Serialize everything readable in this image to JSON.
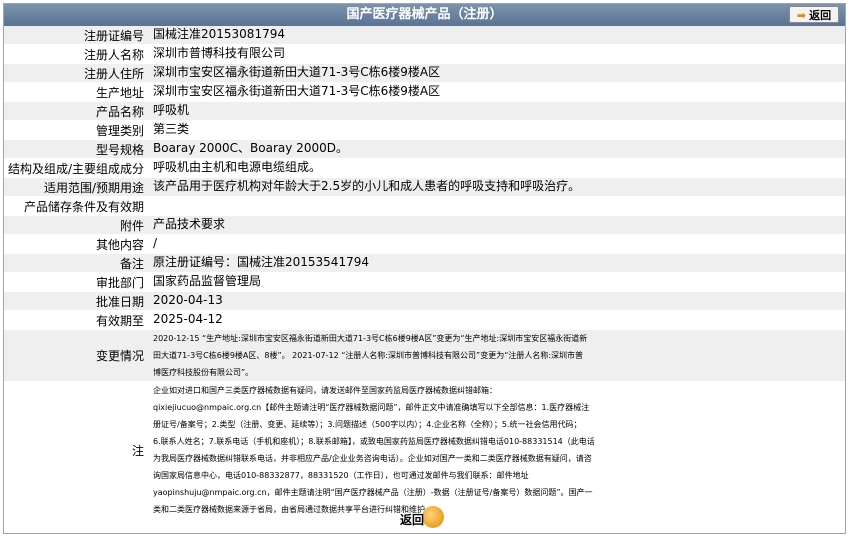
{
  "title": "国产医疗器械产品（注册）",
  "back_top_label": "返回",
  "back_bottom_label": "返回",
  "fields": [
    {
      "label": "注册证编号",
      "value": "国械注准20153081794"
    },
    {
      "label": "注册人名称",
      "value": "深圳市普博科技有限公司"
    },
    {
      "label": "注册人住所",
      "value": "深圳市宝安区福永街道新田大道71-3号C栋6楼9楼A区"
    },
    {
      "label": "生产地址",
      "value": "深圳市宝安区福永街道新田大道71-3号C栋6楼9楼A区"
    },
    {
      "label": "产品名称",
      "value": "呼吸机"
    },
    {
      "label": "管理类别",
      "value": "第三类"
    },
    {
      "label": "型号规格",
      "value": "Boaray 2000C、Boaray 2000D。"
    },
    {
      "label": "结构及组成/主要组成成分",
      "value": "呼吸机由主机和电源电缆组成。"
    },
    {
      "label": "适用范围/预期用途",
      "value": "该产品用于医疗机构对年龄大于2.5岁的小儿和成人患者的呼吸支持和呼吸治疗。"
    },
    {
      "label": "产品储存条件及有效期",
      "value": ""
    },
    {
      "label": "附件",
      "value": "产品技术要求"
    },
    {
      "label": "其他内容",
      "value": "/"
    },
    {
      "label": "备注",
      "value": "原注册证编号：国械注准20153541794"
    },
    {
      "label": "审批部门",
      "value": "国家药品监督管理局"
    },
    {
      "label": "批准日期",
      "value": "2020-04-13"
    },
    {
      "label": "有效期至",
      "value": "2025-04-12"
    }
  ],
  "change": {
    "label": "变更情况",
    "lines": [
      "2020-12-15 “生产地址:深圳市宝安区福永街道新田大道71-3号C栋6楼9楼A区”变更为“生产地址:深圳市宝安区福永街道新",
      "田大道71-3号C栋6楼9楼A区、8楼”。 2021-07-12 “注册人名称:深圳市普博科技有限公司”变更为“注册人名称:深圳市普",
      "博医疗科技股份有限公司”。"
    ]
  },
  "note": {
    "label": "注",
    "lines": [
      "企业如对进口和国产三类医疗器械数据有疑问，请发送邮件至国家药监局医疗器械数据纠错邮箱：",
      "qixiejiucuo@nmpaic.org.cn【邮件主题请注明“医疗器械数据问题”，邮件正文中请准确填写以下全部信息：1.医疗器械注",
      "册证号/备案号；2.类型（注册、变更、延续等）；3.问题描述（500字以内）；4.企业名称（全称）；5.统一社会信用代码；",
      "6.联系人姓名；7.联系电话（手机和座机）；8.联系邮箱】，或致电国家药监局医疗器械数据纠错电话010-88331514（此电话",
      "为我局医疗器械数据纠错联系电话，并非相应产品/企业业务咨询电话）。企业如对国产一类和二类医疗器械数据有疑问，请咨",
      "询国家局信息中心，电话010-88332877，88331520（工作日），也可通过发邮件与我们联系：邮件地址",
      "yaopinshuju@nmpaic.org.cn，邮件主题请注明“国产医疗器械产品（注册）-数据（注册证号/备案号）数据问题”。国产一",
      "类和二类医疗器械数据来源于省局，由省局通过数据共享平台进行纠错和维护。"
    ]
  },
  "colors": {
    "titlebar": "#5a7391",
    "row_alt": "#efefef",
    "back_icon": "#e08a00"
  }
}
